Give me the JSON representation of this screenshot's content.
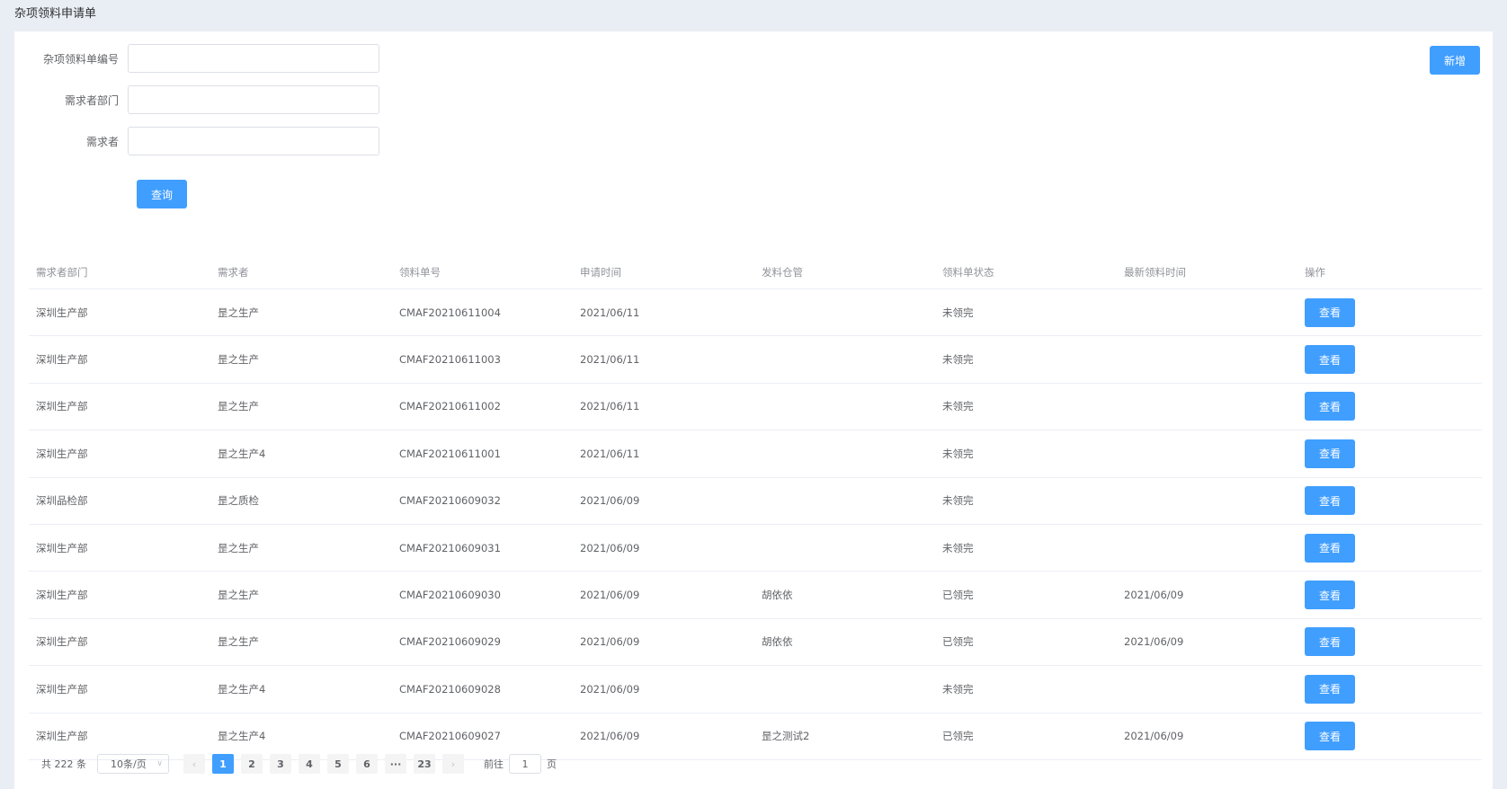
{
  "page": {
    "title": "杂项领料申请单"
  },
  "form": {
    "order_no_label": "杂项领料单编号",
    "order_no_value": "",
    "dept_label": "需求者部门",
    "dept_value": "",
    "requester_label": "需求者",
    "requester_value": "",
    "search_label": "查询",
    "add_label": "新增"
  },
  "colors": {
    "primary": "#409eff",
    "background": "#e9edf4"
  },
  "table": {
    "headers": [
      "需求者部门",
      "需求者",
      "领料单号",
      "申请时间",
      "发料仓管",
      "领料单状态",
      "最新领料时间",
      "操作"
    ],
    "action_label": "查看",
    "rows": [
      [
        "深圳生产部",
        "昰之生产",
        "CMAF20210611004",
        "2021/06/11",
        "",
        "未领完",
        ""
      ],
      [
        "深圳生产部",
        "昰之生产",
        "CMAF20210611003",
        "2021/06/11",
        "",
        "未领完",
        ""
      ],
      [
        "深圳生产部",
        "昰之生产",
        "CMAF20210611002",
        "2021/06/11",
        "",
        "未领完",
        ""
      ],
      [
        "深圳生产部",
        "昰之生产4",
        "CMAF20210611001",
        "2021/06/11",
        "",
        "未领完",
        ""
      ],
      [
        "深圳品检部",
        "昰之质检",
        "CMAF20210609032",
        "2021/06/09",
        "",
        "未领完",
        ""
      ],
      [
        "深圳生产部",
        "昰之生产",
        "CMAF20210609031",
        "2021/06/09",
        "",
        "未领完",
        ""
      ],
      [
        "深圳生产部",
        "昰之生产",
        "CMAF20210609030",
        "2021/06/09",
        "胡依依",
        "已领完",
        "2021/06/09"
      ],
      [
        "深圳生产部",
        "昰之生产",
        "CMAF20210609029",
        "2021/06/09",
        "胡依依",
        "已领完",
        "2021/06/09"
      ],
      [
        "深圳生产部",
        "昰之生产4",
        "CMAF20210609028",
        "2021/06/09",
        "",
        "未领完",
        ""
      ],
      [
        "深圳生产部",
        "昰之生产4",
        "CMAF20210609027",
        "2021/06/09",
        "昰之测试2",
        "已领完",
        "2021/06/09"
      ]
    ]
  },
  "pagination": {
    "total": "共 222 条",
    "page_size": "10条/页",
    "pages": [
      "1",
      "2",
      "3",
      "4",
      "5",
      "6",
      "···",
      "23"
    ],
    "current": "1",
    "prev": "‹",
    "next": "›",
    "goto_prefix": "前往",
    "goto_value": "1",
    "goto_suffix": "页"
  }
}
